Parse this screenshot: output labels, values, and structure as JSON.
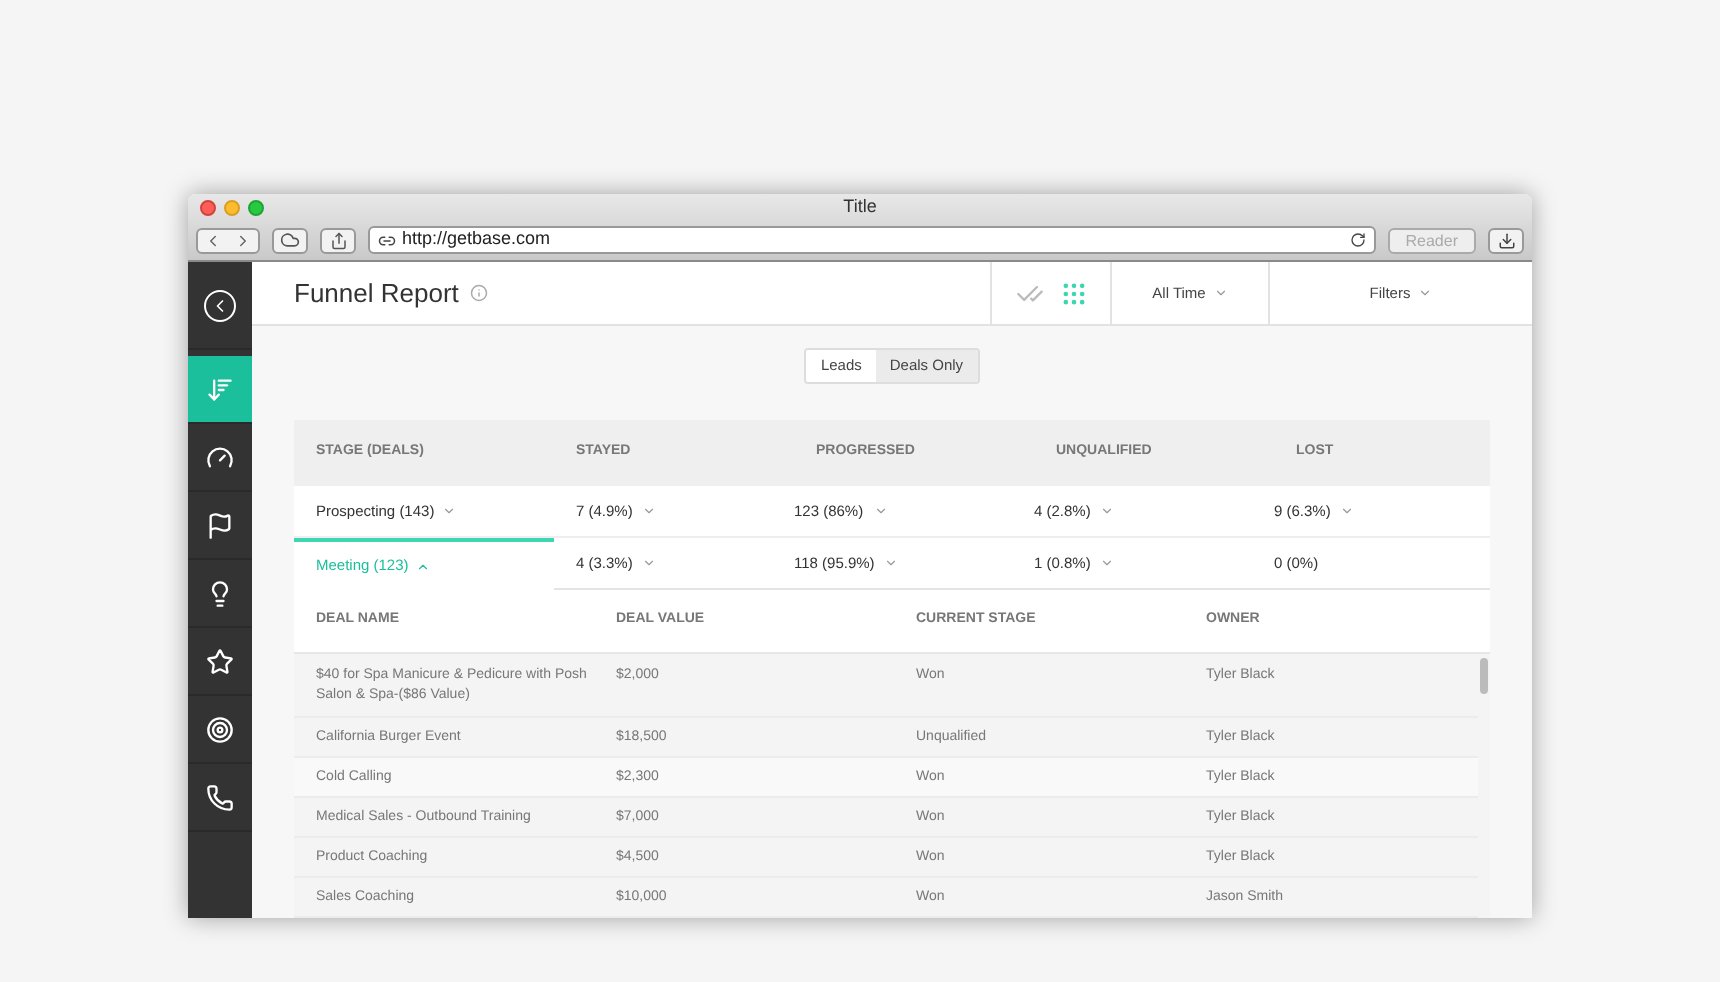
{
  "window": {
    "title": "Title",
    "url": "http://getbase.com",
    "reader": "Reader"
  },
  "sidebar": {
    "items": [
      {
        "kind": "back",
        "selected": false
      },
      {
        "kind": "reports",
        "selected": true
      },
      {
        "kind": "dashboard",
        "selected": false
      },
      {
        "kind": "flag",
        "selected": false
      },
      {
        "kind": "idea",
        "selected": false
      },
      {
        "kind": "star",
        "selected": false
      },
      {
        "kind": "target",
        "selected": false
      },
      {
        "kind": "phone",
        "selected": false
      }
    ]
  },
  "header": {
    "title": "Funnel Report",
    "views": [
      {
        "kind": "check",
        "selected": false
      },
      {
        "kind": "grid",
        "selected": true
      }
    ],
    "period": "All Time",
    "filters": "Filters"
  },
  "toggle": [
    {
      "label": "Leads",
      "selected": true
    },
    {
      "label": "Deals Only",
      "selected": false
    }
  ],
  "funnel": {
    "columns": [
      "STAGE (DEALS)",
      "STAYED",
      "PROGRESSED",
      "UNQUALIFIED",
      "LOST"
    ],
    "rows": [
      {
        "selected": false,
        "expanded": false,
        "cells": [
          {
            "text": "Prospecting (143)",
            "menu": true
          },
          {
            "text": "7 (4.9%)",
            "menu": true
          },
          {
            "text": "123 (86%)",
            "menu": true
          },
          {
            "text": "4 (2.8%)",
            "menu": true
          },
          {
            "text": "9 (6.3%)",
            "menu": true
          }
        ]
      },
      {
        "selected": true,
        "expanded": true,
        "cells": [
          {
            "text": "Meeting (123)",
            "menu": true
          },
          {
            "text": "4 (3.3%)",
            "menu": true
          },
          {
            "text": "118 (95.9%)",
            "menu": true
          },
          {
            "text": "1 (0.8%)",
            "menu": true
          },
          {
            "text": "0 (0%)",
            "menu": false
          }
        ]
      }
    ]
  },
  "deals": {
    "columns": [
      "DEAL NAME",
      "DEAL VALUE",
      "CURRENT STAGE",
      "OWNER"
    ],
    "rows": [
      [
        "$40 for Spa Manicure & Pedicure with Posh Salon & Spa-($86 Value)",
        "$2,000",
        "Won",
        "Tyler Black"
      ],
      [
        "California Burger Event",
        "$18,500",
        "Unqualified",
        "Tyler Black"
      ],
      [
        "Cold Calling",
        "$2,300",
        "Won",
        "Tyler Black"
      ],
      [
        "Medical Sales - Outbound Training",
        "$7,000",
        "Won",
        "Tyler Black"
      ],
      [
        "Product Coaching",
        "$4,500",
        "Won",
        "Tyler Black"
      ],
      [
        "Sales Coaching",
        "$10,000",
        "Won",
        "Jason Smith"
      ]
    ]
  }
}
